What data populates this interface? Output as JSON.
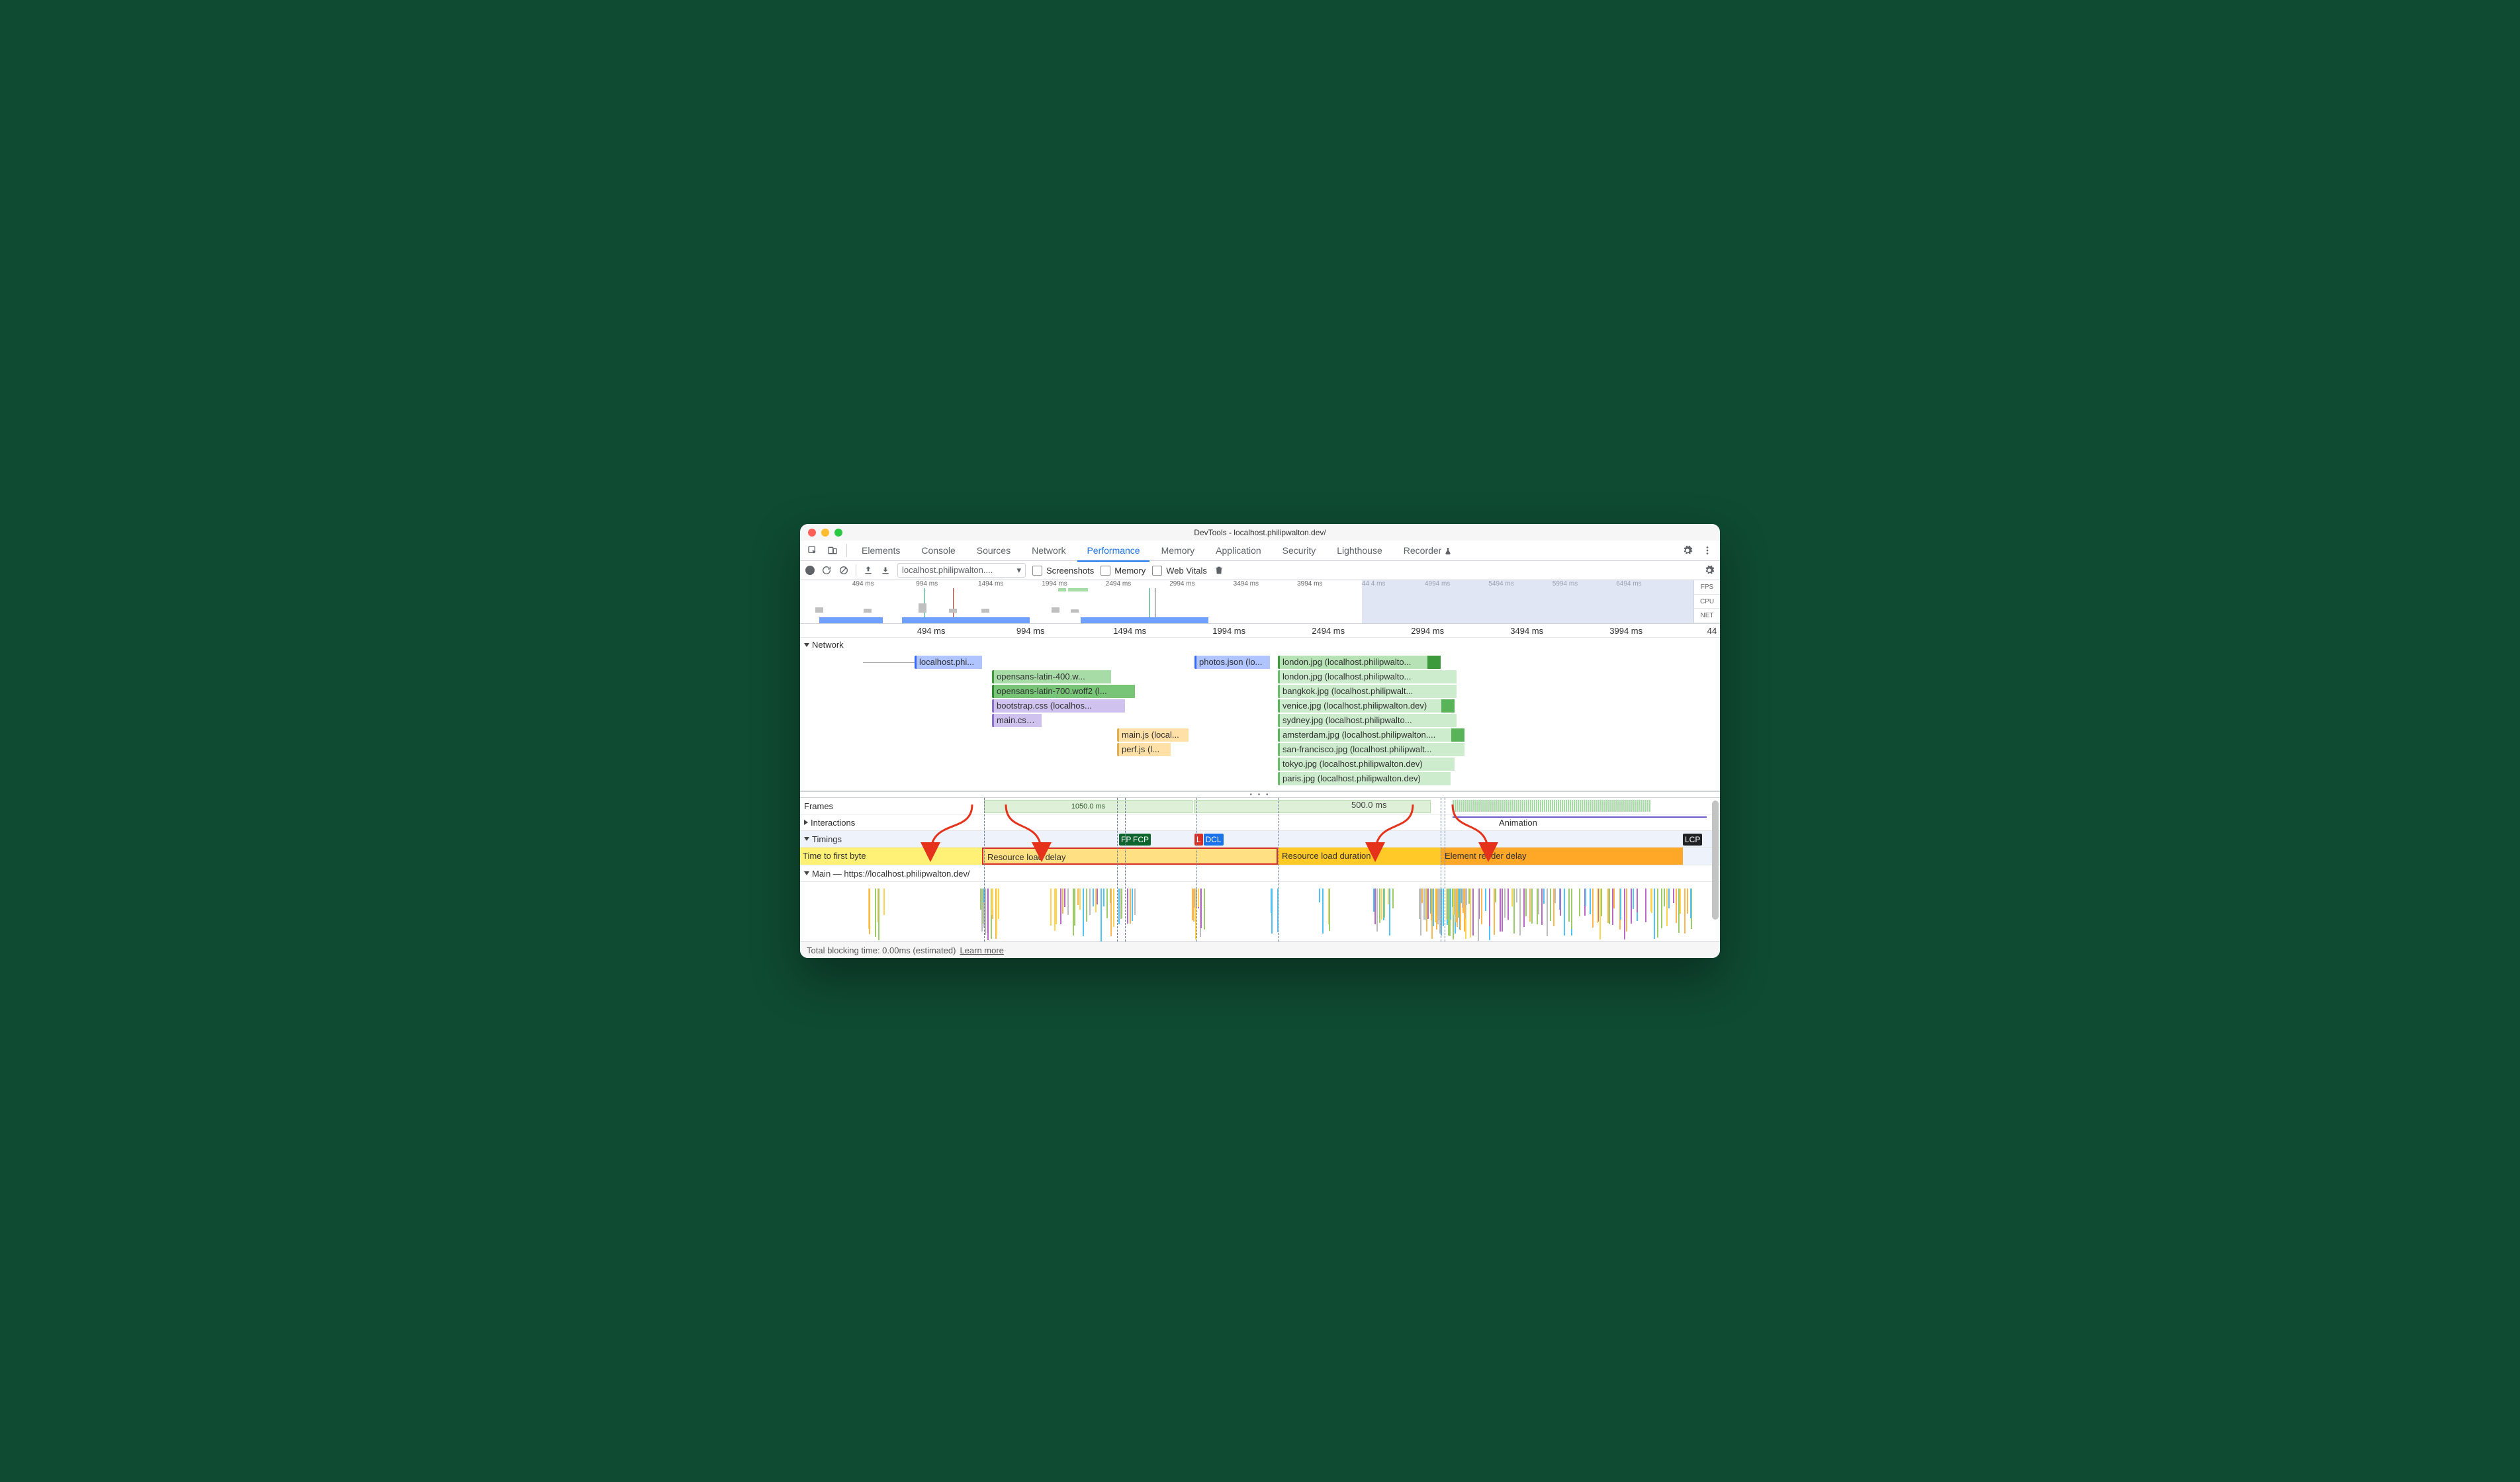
{
  "window_title": "DevTools - localhost.philipwalton.dev/",
  "tabs": {
    "elements": "Elements",
    "console": "Console",
    "sources": "Sources",
    "network": "Network",
    "performance": "Performance",
    "memory": "Memory",
    "application": "Application",
    "security": "Security",
    "lighthouse": "Lighthouse",
    "recorder": "Recorder"
  },
  "perfbar": {
    "selected": "localhost.philipwalton....",
    "screenshots": "Screenshots",
    "memory": "Memory",
    "webvitals": "Web Vitals"
  },
  "overview": {
    "ticks": [
      "494 ms",
      "994 ms",
      "1494 ms",
      "1994 ms",
      "2494 ms",
      "2994 ms",
      "3494 ms",
      "3994 ms",
      "44 4 ms",
      "4994 ms",
      "5494 ms",
      "5994 ms",
      "6494 ms"
    ],
    "right": [
      "FPS",
      "CPU",
      "NET"
    ],
    "max_ms": 7000,
    "viewport_ms": [
      0,
      4400
    ]
  },
  "ruler": {
    "ticks": [
      {
        "ms": 494,
        "label": "494 ms"
      },
      {
        "ms": 994,
        "label": "994 ms"
      },
      {
        "ms": 1494,
        "label": "1494 ms"
      },
      {
        "ms": 1994,
        "label": "1994 ms"
      },
      {
        "ms": 2494,
        "label": "2494 ms"
      },
      {
        "ms": 2994,
        "label": "2994 ms"
      },
      {
        "ms": 3494,
        "label": "3494 ms"
      },
      {
        "ms": 3994,
        "label": "3994 ms"
      }
    ],
    "last": "44",
    "max_ms": 4400
  },
  "network": {
    "header": "Network",
    "requests": [
      {
        "row": 0,
        "start": 410,
        "end": 750,
        "label": "localhost.phi...",
        "color": "#b0c4ff",
        "border": "#3366ff",
        "pre": 150
      },
      {
        "row": 1,
        "start": 800,
        "end": 1400,
        "label": "opensans-latin-400.w...",
        "color": "#a7dca7",
        "border": "#3c9a3c"
      },
      {
        "row": 2,
        "start": 800,
        "end": 1520,
        "label": "opensans-latin-700.woff2 (l...",
        "color": "#78c578",
        "border": "#2f8a2f"
      },
      {
        "row": 3,
        "start": 800,
        "end": 1470,
        "label": "bootstrap.css (localhos...",
        "color": "#d0c2ef",
        "border": "#8a6fd1"
      },
      {
        "row": 4,
        "start": 800,
        "end": 1050,
        "label": "main.css ...",
        "color": "#d0c2ef",
        "border": "#8a6fd1"
      },
      {
        "row": 5,
        "start": 1430,
        "end": 1790,
        "label": "main.js (local...",
        "color": "#ffe1a8",
        "border": "#e0b050"
      },
      {
        "row": 6,
        "start": 1430,
        "end": 1700,
        "label": "perf.js (l...",
        "color": "#ffe1a8",
        "border": "#e0b050"
      },
      {
        "row": 0,
        "start": 1820,
        "end": 2200,
        "second": true,
        "label": "photos.json (lo...",
        "color": "#b0c4ff",
        "border": "#3366ff",
        "pre": 2150
      },
      {
        "row": 0,
        "start": 2240,
        "end": 3060,
        "third": true,
        "label": "london.jpg (localhost.philipwalto...",
        "color": "#b6e2b6",
        "border": "#3c9a3c",
        "dark": true
      },
      {
        "row": 1,
        "start": 2240,
        "end": 3140,
        "second": true,
        "label": "london.jpg (localhost.philipwalto...",
        "color": "#cdeccd",
        "border": "#6dbb6d"
      },
      {
        "row": 2,
        "start": 2240,
        "end": 3140,
        "second": true,
        "label": "bangkok.jpg (localhost.philipwalt...",
        "color": "#cdeccd",
        "border": "#6dbb6d"
      },
      {
        "row": 3,
        "start": 2240,
        "end": 3130,
        "second": true,
        "label": "venice.jpg (localhost.philipwalton.dev)",
        "color": "#cdeccd",
        "border": "#59b359",
        "dark": true
      },
      {
        "row": 4,
        "start": 2240,
        "end": 3140,
        "second": true,
        "label": "sydney.jpg (localhost.philipwalto...",
        "color": "#cdeccd",
        "border": "#6dbb6d"
      },
      {
        "row": 5,
        "start": 2240,
        "end": 3180,
        "second": true,
        "label": "amsterdam.jpg (localhost.philipwalton....",
        "color": "#cdeccd",
        "border": "#59b359",
        "dark": true
      },
      {
        "row": 6,
        "start": 2240,
        "end": 3180,
        "second": true,
        "label": "san-francisco.jpg (localhost.philipwalt...",
        "color": "#cdeccd",
        "border": "#6dbb6d"
      },
      {
        "row": 7,
        "start": 2240,
        "end": 3130,
        "second": true,
        "label": "tokyo.jpg (localhost.philipwalton.dev)",
        "color": "#cdeccd",
        "border": "#6dbb6d"
      },
      {
        "row": 8,
        "start": 2240,
        "end": 3110,
        "second": true,
        "label": "paris.jpg (localhost.philipwalton.dev)",
        "color": "#cdeccd",
        "border": "#6dbb6d"
      }
    ]
  },
  "frames": {
    "header": "Frames",
    "values": [
      "1050.0 ms",
      "500.0 ms"
    ],
    "animation": "Animation"
  },
  "interactions": {
    "header": "Interactions"
  },
  "timings": {
    "header": "Timings",
    "markers": [
      {
        "ms": 1440,
        "label": "FP",
        "color": "#0d652d"
      },
      {
        "ms": 1500,
        "label": "FCP",
        "color": "#0d652d"
      },
      {
        "ms": 1820,
        "label": "L",
        "color": "#d93025"
      },
      {
        "ms": 1865,
        "label": "DCL",
        "color": "#1a73e8"
      },
      {
        "ms": 4280,
        "label": "LCP",
        "color": "#202124"
      }
    ],
    "segments": [
      {
        "label": "Time to first byte",
        "ms_end": 750
      },
      {
        "label": "Resource load delay",
        "ms_end": 2240
      },
      {
        "label": "Resource load duration",
        "ms_end": 3060
      },
      {
        "label": "Element render delay",
        "ms_end": 4280
      }
    ]
  },
  "main": {
    "header": "Main — https://localhost.philipwalton.dev/"
  },
  "dashed_markers_ms": [
    760,
    1430,
    1470,
    1830,
    2240,
    3060,
    3080
  ],
  "status": {
    "text": "Total blocking time: 0.00ms (estimated)",
    "link": "Learn more"
  }
}
